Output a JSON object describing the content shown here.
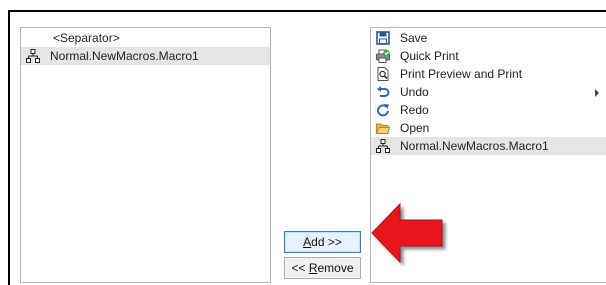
{
  "left_list": {
    "items": [
      {
        "label": "<Separator>",
        "icon": "none",
        "selected": false
      },
      {
        "label": "Normal.NewMacros.Macro1",
        "icon": "macro-icon",
        "selected": true
      }
    ]
  },
  "right_list": {
    "items": [
      {
        "label": "Save",
        "icon": "save-icon"
      },
      {
        "label": "Quick Print",
        "icon": "quick-print-icon"
      },
      {
        "label": "Print Preview and Print",
        "icon": "print-preview-icon"
      },
      {
        "label": "Undo",
        "icon": "undo-icon",
        "has_submenu": true
      },
      {
        "label": "Redo",
        "icon": "redo-icon"
      },
      {
        "label": "Open",
        "icon": "folder-icon"
      },
      {
        "label": "Normal.NewMacros.Macro1",
        "icon": "macro-icon",
        "selected": true
      }
    ]
  },
  "buttons": {
    "add": {
      "prefix": "",
      "accel": "A",
      "rest": "dd >>"
    },
    "remove": {
      "prefix": "<< ",
      "accel": "R",
      "rest": "emove"
    }
  },
  "colors": {
    "selection": "#e5e5e5",
    "arrow": "#e8171c",
    "save_icon": "#2b5797",
    "undo_icon": "#2a6ebd"
  }
}
